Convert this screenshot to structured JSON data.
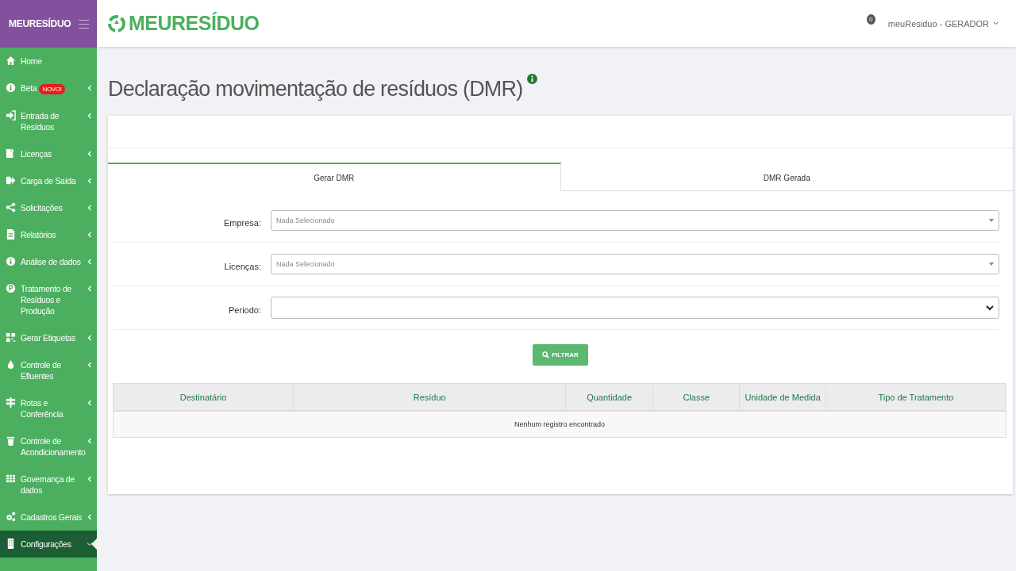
{
  "sidebar": {
    "logo": "MEURESÍDUO",
    "items": [
      {
        "label": "Home",
        "submenu": false,
        "expanded": false,
        "selected": false
      },
      {
        "label": "Beta",
        "badge": "NOVO!",
        "submenu": true,
        "expanded": false,
        "selected": false
      },
      {
        "label": "Entrada de Resíduos",
        "submenu": true,
        "expanded": false,
        "selected": false
      },
      {
        "label": "Licenças",
        "submenu": true,
        "expanded": false,
        "selected": false
      },
      {
        "label": "Carga de Saída",
        "submenu": true,
        "expanded": false,
        "selected": false
      },
      {
        "label": "Solicitações",
        "submenu": true,
        "expanded": false,
        "selected": false
      },
      {
        "label": "Relatórios",
        "submenu": true,
        "expanded": false,
        "selected": false
      },
      {
        "label": "Análise de dados",
        "submenu": true,
        "expanded": false,
        "selected": false
      },
      {
        "label": "Tratamento de Resíduos e Produção",
        "submenu": true,
        "expanded": false,
        "selected": false
      },
      {
        "label": "Gerar Etiquetas",
        "submenu": true,
        "expanded": false,
        "selected": false
      },
      {
        "label": "Controle de Efluentes",
        "submenu": true,
        "expanded": false,
        "selected": false
      },
      {
        "label": "Rotas e Conferência",
        "submenu": true,
        "expanded": false,
        "selected": false
      },
      {
        "label": "Controle de Acondicionamento",
        "submenu": true,
        "expanded": false,
        "selected": false
      },
      {
        "label": "Governança de dados",
        "submenu": true,
        "expanded": false,
        "selected": false
      },
      {
        "label": "Cadastros Gerais",
        "submenu": true,
        "expanded": false,
        "selected": false
      },
      {
        "label": "Configurações",
        "submenu": true,
        "expanded": true,
        "selected": true
      }
    ]
  },
  "topbar": {
    "logo": "MEURESÍDUO",
    "notifications": "0",
    "user": "meuResiduo - GERADOR"
  },
  "page": {
    "title": "Declaração movimentação de resíduos (DMR)"
  },
  "tabs": [
    {
      "label": "Gerar DMR",
      "selected": true
    },
    {
      "label": "DMR Gerada",
      "selected": false
    }
  ],
  "fields": [
    {
      "label": "Empresa:",
      "kind": "picker",
      "placeholder": "Nada Selecionado"
    },
    {
      "label": "Licenças:",
      "kind": "picker",
      "placeholder": "Nada Selecionado"
    },
    {
      "label": "Periodo:",
      "kind": "select"
    }
  ],
  "filter_button": "FILTRAR",
  "table": {
    "columns": [
      "Destinatário",
      "Resíduo",
      "Quantidade",
      "Classe",
      "Unidade de Medida",
      "Tipo de Tratamento"
    ],
    "empty_message": "Nenhum registro encontrado"
  }
}
